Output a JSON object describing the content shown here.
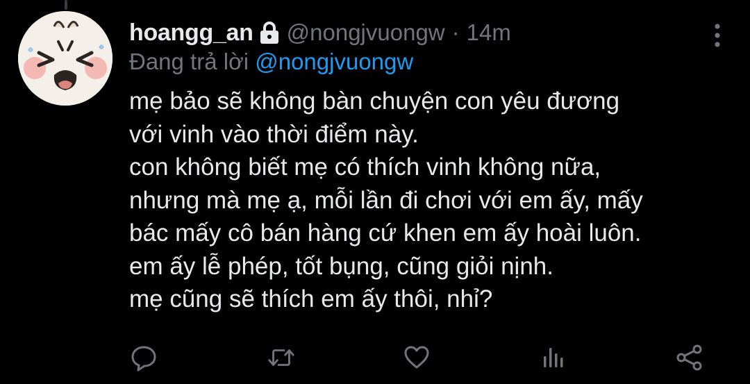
{
  "tweet": {
    "display_name": "hoangg_an",
    "protected_icon": "lock-icon",
    "handle": "@nongjvuongw",
    "separator": "·",
    "time": "14m",
    "reply_prefix": "Đang trả lời",
    "reply_to": "@nongjvuongw",
    "body_lines": [
      "mẹ bảo sẽ không bàn chuyện con yêu đương",
      "với vinh vào thời điểm này.",
      "con không biết mẹ có thích vinh không nữa,",
      "nhưng mà mẹ ạ, mỗi lần đi chơi với em ấy, mấy",
      "bác mấy cô bán hàng cứ khen em ấy hoài luôn.",
      "em ấy lễ phép, tốt bụng, cũng giỏi nịnh.",
      "mẹ cũng sẽ thích em ấy thôi, nhỉ?"
    ]
  },
  "actions": [
    {
      "name": "reply",
      "icon": "reply-icon"
    },
    {
      "name": "retweet",
      "icon": "retweet-icon"
    },
    {
      "name": "like",
      "icon": "heart-icon"
    },
    {
      "name": "views",
      "icon": "analytics-icon"
    },
    {
      "name": "share",
      "icon": "share-icon"
    }
  ],
  "colors": {
    "background": "#000000",
    "text_primary": "#e7e9ea",
    "text_secondary": "#71767b",
    "accent": "#1d9bf0"
  }
}
